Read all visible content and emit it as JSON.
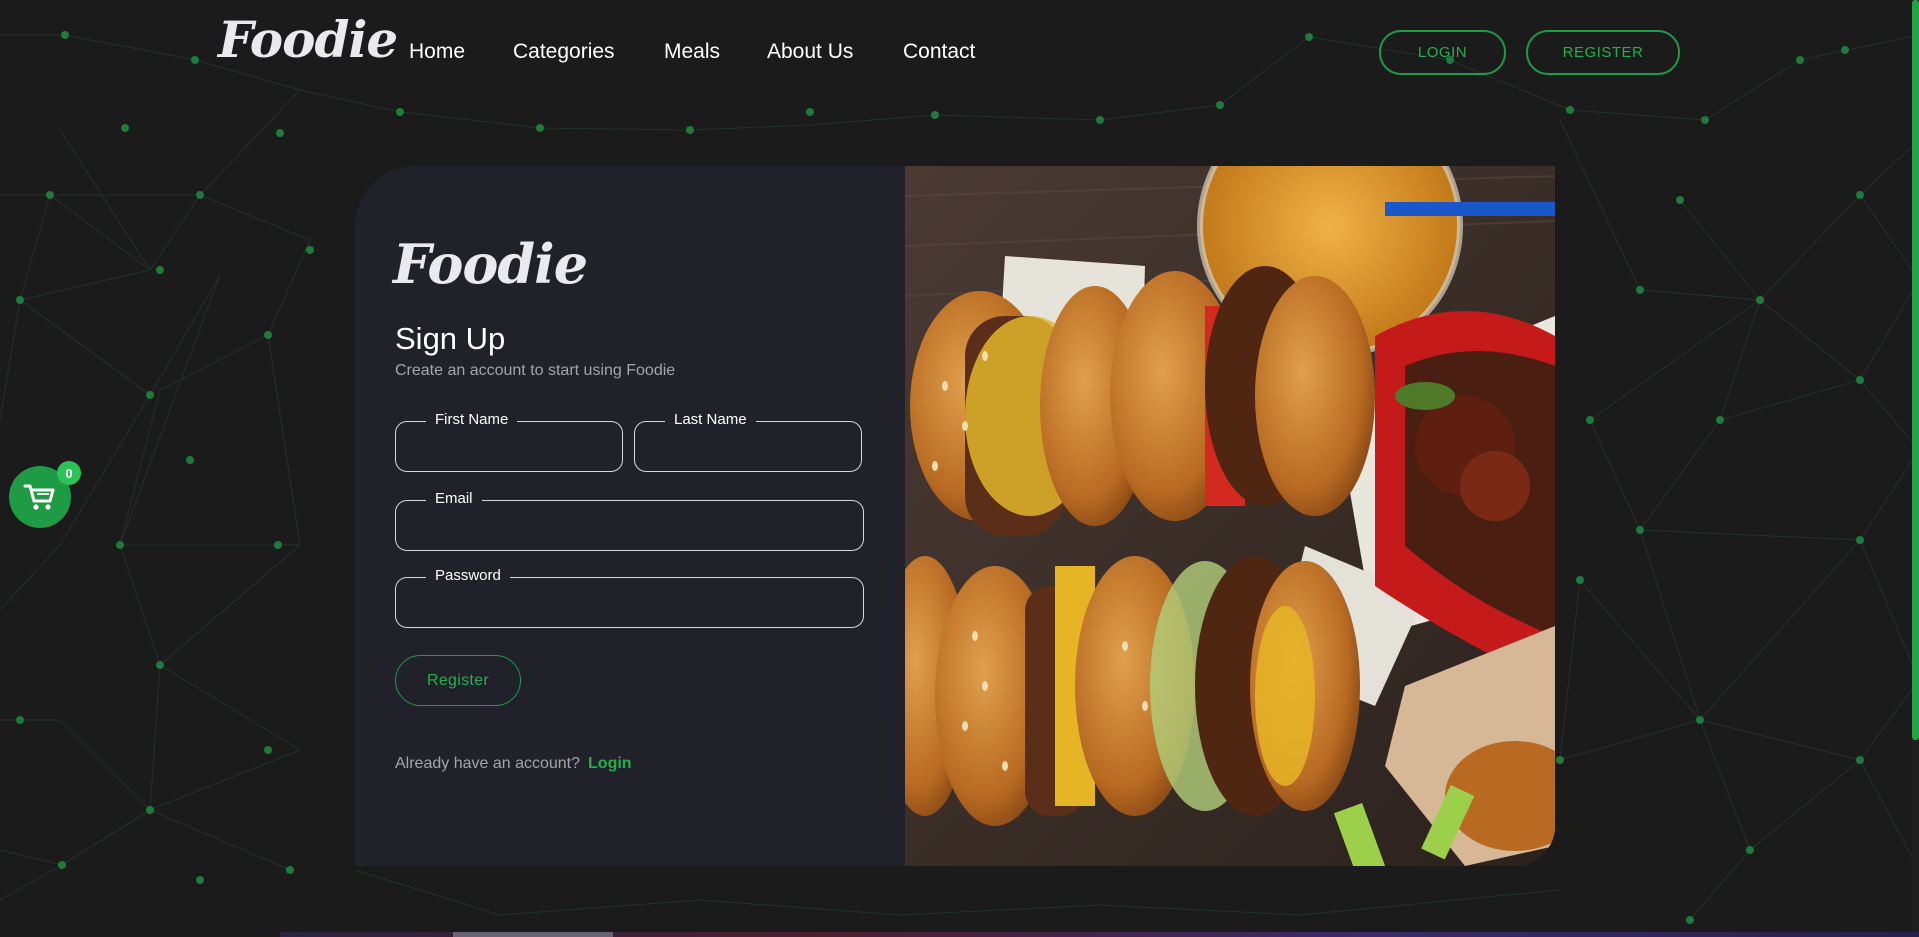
{
  "brand": {
    "name": "Foodie",
    "accent_color": "#22a344"
  },
  "nav": {
    "links": [
      "Home",
      "Categories",
      "Meals",
      "About Us",
      "Contact"
    ],
    "login_label": "LOGIN",
    "register_label": "REGISTER"
  },
  "cart": {
    "count": "0",
    "icon": "shopping-cart-icon"
  },
  "signup": {
    "title": "Sign Up",
    "subtitle": "Create an account to start using Foodie",
    "fields": {
      "first_name": "First Name",
      "last_name": "Last Name",
      "email": "Email",
      "password": "Password"
    },
    "submit_label": "Register",
    "already_text": "Already have an account?",
    "login_link": "Login"
  },
  "hero_image": {
    "icon": "burger-food-photo"
  }
}
